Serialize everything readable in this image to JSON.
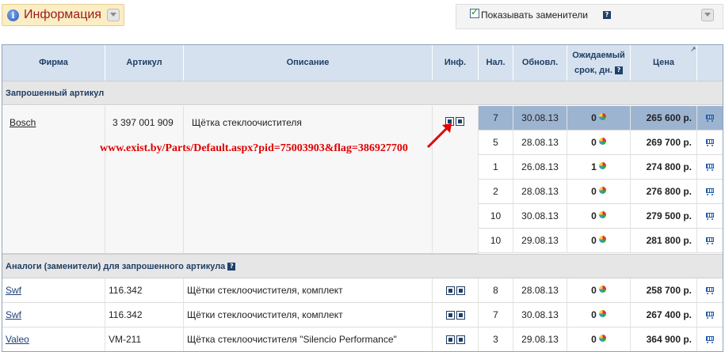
{
  "top": {
    "info_label": "Информация",
    "show_substitutes_label": "Показывать заменители",
    "show_substitutes_checked": true
  },
  "table": {
    "headers": [
      "Фирма",
      "Артикул",
      "Описание",
      "Инф.",
      "Нал.",
      "Обновл.",
      "Ожидаемый срок, дн.",
      "Цена"
    ],
    "requested_section": "Запрошенный артикул",
    "requested": {
      "firm": "Bosch",
      "article": "3 397 001 909",
      "description": "Щётка стеклоочистителя",
      "offers": [
        {
          "qty": "7",
          "updated": "30.08.13",
          "term": "0",
          "price": "265 600 р.",
          "selected": true
        },
        {
          "qty": "5",
          "updated": "28.08.13",
          "term": "0",
          "price": "269 700 р.",
          "selected": false
        },
        {
          "qty": "1",
          "updated": "26.08.13",
          "term": "1",
          "price": "274 800 р.",
          "selected": false
        },
        {
          "qty": "2",
          "updated": "28.08.13",
          "term": "0",
          "price": "276 800 р.",
          "selected": false
        },
        {
          "qty": "10",
          "updated": "30.08.13",
          "term": "0",
          "price": "279 500 р.",
          "selected": false
        },
        {
          "qty": "10",
          "updated": "29.08.13",
          "term": "0",
          "price": "281 800 р.",
          "selected": false
        }
      ]
    },
    "analogs_section": "Аналоги (заменители) для запрошенного артикула",
    "analogs": [
      {
        "firm": "Swf",
        "article": "116.342",
        "description": "Щётки стеклоочистителя, комплект",
        "qty": "8",
        "updated": "28.08.13",
        "term": "0",
        "price": "258 700 р."
      },
      {
        "firm": "Swf",
        "article": "116.342",
        "description": "Щётки стеклоочистителя, комплект",
        "qty": "7",
        "updated": "30.08.13",
        "term": "0",
        "price": "267 400 р."
      },
      {
        "firm": "Valeo",
        "article": "VM-211",
        "description": "Щётка стеклоочистителя \"Silencio Performance\"",
        "qty": "3",
        "updated": "29.08.13",
        "term": "0",
        "price": "364 900 р."
      }
    ]
  },
  "annotation": {
    "url_text": "www.exist.by/Parts/Default.aspx?pid=75003903&flag=386927700",
    "color": "#e00000"
  },
  "colors": {
    "header_bg": "#d5e1ee",
    "selected_row": "#9db4d1",
    "accent_text": "#1f3e66"
  }
}
